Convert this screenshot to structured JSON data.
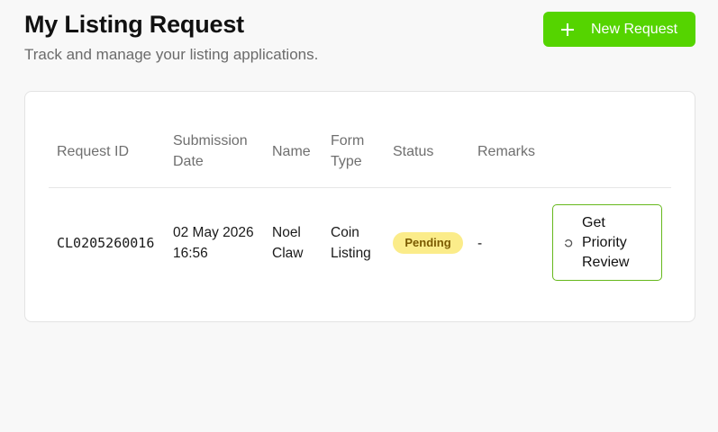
{
  "header": {
    "title": "My Listing Request",
    "subtitle": "Track and manage your listing applications.",
    "new_request_label": "New Request",
    "accent": "#55d400"
  },
  "table": {
    "columns": {
      "request_id": "Request ID",
      "submission_date_1": "Submission",
      "submission_date_2": "Date",
      "name": "Name",
      "form_type_1": "Form",
      "form_type_2": "Type",
      "status": "Status",
      "remarks": "Remarks"
    },
    "rows": [
      {
        "request_id": "CL0205260016",
        "date": "02 May 2026",
        "time": "16:56",
        "name_first": "Noel",
        "name_last": "Claw",
        "form_type_1": "Coin",
        "form_type_2": "Listing",
        "status": "Pending",
        "status_color": "#fbec8a",
        "remarks": "-",
        "action_1": "Get",
        "action_2": "Priority",
        "action_3": "Review",
        "action_icon": "loading-spinner-icon"
      }
    ]
  }
}
